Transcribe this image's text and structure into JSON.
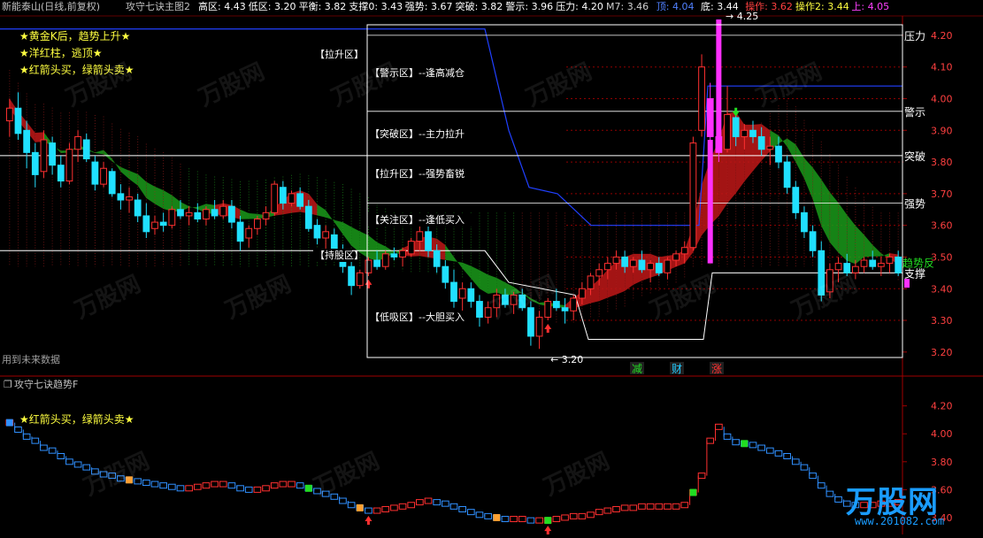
{
  "header": {
    "stock": "新能泰山(日线,前复权)",
    "indicator": "攻守七诀主图2",
    "fields": [
      {
        "label": "高区:",
        "value": "4.43",
        "color": "#ffffff"
      },
      {
        "label": "低区:",
        "value": "3.20",
        "color": "#ffffff"
      },
      {
        "label": "平衡:",
        "value": "3.82",
        "color": "#ffffff"
      },
      {
        "label": "支撑0:",
        "value": "3.43",
        "color": "#ffffff"
      },
      {
        "label": "强势:",
        "value": "3.67",
        "color": "#ffffff"
      },
      {
        "label": "突破:",
        "value": "3.82",
        "color": "#ffffff"
      },
      {
        "label": "警示:",
        "value": "3.96",
        "color": "#ffffff"
      },
      {
        "label": "压力:",
        "value": "4.20",
        "color": "#ffffff"
      },
      {
        "label": "M7:",
        "value": "3.46",
        "color": "#d0d0d0"
      },
      {
        "label": "顶:",
        "value": "4.04",
        "color": "#5080ff"
      },
      {
        "label": "底:",
        "value": "3.44",
        "color": "#ffffff"
      },
      {
        "label": "操作:",
        "value": "3.62",
        "color": "#ff4040"
      },
      {
        "label": "操作2:",
        "value": "3.44",
        "color": "#ffff40"
      },
      {
        "label": "上:",
        "value": "4.05",
        "color": "#ff40ff"
      }
    ]
  },
  "legend_notes": [
    "★黄金K后，趋势上升★",
    "★洋红柱，逃顶★",
    "★红箭头买，绿箭头卖★"
  ],
  "zone_box": {
    "title": "【拉升区】",
    "rows": [
      "【警示区】--逢高减仓",
      "【突破区】--主力拉升",
      "【拉升区】--强势畜锐",
      "【关注区】--逢低买入",
      "【持股区】",
      "【低吸区】--大胆买入"
    ]
  },
  "level_labels": [
    "压力",
    "警示",
    "突破",
    "强势",
    "支撑"
  ],
  "misc": {
    "future_warn": "用到未来数据",
    "high_mark": "4.25",
    "low_mark": "3.20",
    "right_note": "趋势反",
    "bottom_tags": [
      {
        "t": "减",
        "c": "#22dd22"
      },
      {
        "t": "财",
        "c": "#22ccff"
      },
      {
        "t": "涨",
        "c": "#ff3030"
      }
    ]
  },
  "sub_panel": {
    "title": "攻守七诀趋势F",
    "note": "★红箭头买，绿箭头卖★"
  },
  "brand": {
    "name": "万股网",
    "url": "www.201082.com",
    "watermark": "万股网"
  },
  "colors": {
    "up": "#ff3030",
    "down": "#20e0ff",
    "ma_green": "#1a9a1a",
    "ma_red": "#c01818",
    "magenta": "#ff30ff",
    "top_line": "#2040ff",
    "axis_text": "#ff4040",
    "grid": "#900000"
  },
  "chart_data": [
    {
      "type": "candlestick",
      "panel": "main",
      "ylim": [
        3.18,
        4.25
      ],
      "yticks": [
        3.2,
        3.3,
        3.4,
        3.5,
        3.6,
        3.7,
        3.8,
        3.9,
        4.0,
        4.1,
        4.2
      ],
      "levels": {
        "压力": 4.2,
        "警示": 3.96,
        "突破": 3.82,
        "强势": 3.67,
        "支撑": 3.45
      },
      "candles": [
        [
          3.93,
          4.0,
          3.88,
          3.97
        ],
        [
          3.97,
          4.02,
          3.87,
          3.89
        ],
        [
          3.9,
          3.93,
          3.78,
          3.83
        ],
        [
          3.83,
          3.86,
          3.72,
          3.76
        ],
        [
          3.77,
          3.9,
          3.75,
          3.87
        ],
        [
          3.86,
          3.88,
          3.76,
          3.79
        ],
        [
          3.79,
          3.82,
          3.72,
          3.74
        ],
        [
          3.74,
          3.86,
          3.73,
          3.84
        ],
        [
          3.84,
          3.9,
          3.8,
          3.88
        ],
        [
          3.87,
          3.89,
          3.8,
          3.81
        ],
        [
          3.8,
          3.82,
          3.71,
          3.73
        ],
        [
          3.73,
          3.8,
          3.72,
          3.78
        ],
        [
          3.77,
          3.78,
          3.69,
          3.7
        ],
        [
          3.7,
          3.73,
          3.65,
          3.68
        ],
        [
          3.68,
          3.72,
          3.64,
          3.69
        ],
        [
          3.68,
          3.7,
          3.61,
          3.63
        ],
        [
          3.63,
          3.67,
          3.56,
          3.58
        ],
        [
          3.59,
          3.63,
          3.57,
          3.61
        ],
        [
          3.61,
          3.64,
          3.58,
          3.6
        ],
        [
          3.6,
          3.66,
          3.59,
          3.65
        ],
        [
          3.65,
          3.68,
          3.62,
          3.63
        ],
        [
          3.63,
          3.66,
          3.6,
          3.64
        ],
        [
          3.64,
          3.67,
          3.61,
          3.62
        ],
        [
          3.62,
          3.66,
          3.6,
          3.65
        ],
        [
          3.65,
          3.68,
          3.62,
          3.63
        ],
        [
          3.63,
          3.68,
          3.62,
          3.66
        ],
        [
          3.66,
          3.68,
          3.59,
          3.61
        ],
        [
          3.61,
          3.63,
          3.52,
          3.55
        ],
        [
          3.56,
          3.6,
          3.53,
          3.59
        ],
        [
          3.59,
          3.63,
          3.57,
          3.62
        ],
        [
          3.62,
          3.66,
          3.6,
          3.64
        ],
        [
          3.64,
          3.74,
          3.63,
          3.73
        ],
        [
          3.72,
          3.74,
          3.65,
          3.67
        ],
        [
          3.67,
          3.71,
          3.66,
          3.7
        ],
        [
          3.7,
          3.72,
          3.65,
          3.66
        ],
        [
          3.66,
          3.68,
          3.58,
          3.59
        ],
        [
          3.6,
          3.62,
          3.54,
          3.56
        ],
        [
          3.56,
          3.6,
          3.52,
          3.58
        ],
        [
          3.57,
          3.59,
          3.5,
          3.51
        ],
        [
          3.51,
          3.54,
          3.45,
          3.47
        ],
        [
          3.47,
          3.49,
          3.38,
          3.41
        ],
        [
          3.41,
          3.46,
          3.4,
          3.45
        ],
        [
          3.45,
          3.5,
          3.44,
          3.49
        ],
        [
          3.49,
          3.52,
          3.46,
          3.47
        ],
        [
          3.47,
          3.52,
          3.46,
          3.51
        ],
        [
          3.51,
          3.53,
          3.49,
          3.5
        ],
        [
          3.5,
          3.53,
          3.47,
          3.52
        ],
        [
          3.51,
          3.56,
          3.5,
          3.55
        ],
        [
          3.55,
          3.6,
          3.52,
          3.58
        ],
        [
          3.58,
          3.6,
          3.5,
          3.52
        ],
        [
          3.52,
          3.54,
          3.45,
          3.47
        ],
        [
          3.47,
          3.49,
          3.4,
          3.42
        ],
        [
          3.42,
          3.46,
          3.34,
          3.36
        ],
        [
          3.37,
          3.42,
          3.33,
          3.4
        ],
        [
          3.4,
          3.42,
          3.34,
          3.36
        ],
        [
          3.36,
          3.38,
          3.28,
          3.31
        ],
        [
          3.31,
          3.36,
          3.29,
          3.34
        ],
        [
          3.34,
          3.4,
          3.31,
          3.38
        ],
        [
          3.38,
          3.4,
          3.34,
          3.35
        ],
        [
          3.35,
          3.39,
          3.32,
          3.38
        ],
        [
          3.38,
          3.4,
          3.33,
          3.34
        ],
        [
          3.34,
          3.36,
          3.22,
          3.25
        ],
        [
          3.25,
          3.33,
          3.21,
          3.31
        ],
        [
          3.31,
          3.37,
          3.3,
          3.36
        ],
        [
          3.36,
          3.4,
          3.33,
          3.34
        ],
        [
          3.34,
          3.37,
          3.29,
          3.33
        ],
        [
          3.33,
          3.38,
          3.3,
          3.37
        ],
        [
          3.37,
          3.42,
          3.35,
          3.4
        ],
        [
          3.4,
          3.45,
          3.38,
          3.44
        ],
        [
          3.44,
          3.48,
          3.41,
          3.46
        ],
        [
          3.46,
          3.5,
          3.43,
          3.48
        ],
        [
          3.48,
          3.52,
          3.46,
          3.5
        ],
        [
          3.5,
          3.52,
          3.45,
          3.47
        ],
        [
          3.47,
          3.5,
          3.45,
          3.49
        ],
        [
          3.49,
          3.52,
          3.45,
          3.46
        ],
        [
          3.46,
          3.49,
          3.42,
          3.48
        ],
        [
          3.48,
          3.5,
          3.44,
          3.45
        ],
        [
          3.45,
          3.5,
          3.43,
          3.49
        ],
        [
          3.49,
          3.52,
          3.47,
          3.51
        ],
        [
          3.51,
          3.55,
          3.48,
          3.53
        ],
        [
          3.53,
          3.88,
          3.52,
          3.86
        ],
        [
          3.9,
          4.14,
          3.88,
          4.1
        ],
        [
          4.0,
          4.05,
          3.85,
          3.88
        ],
        [
          3.88,
          3.92,
          3.8,
          3.83
        ],
        [
          3.84,
          4.04,
          3.83,
          3.95
        ],
        [
          3.94,
          3.96,
          3.85,
          3.88
        ],
        [
          3.88,
          3.92,
          3.84,
          3.9
        ],
        [
          3.9,
          3.93,
          3.86,
          3.88
        ],
        [
          3.88,
          3.91,
          3.82,
          3.84
        ],
        [
          3.84,
          3.88,
          3.79,
          3.85
        ],
        [
          3.85,
          3.88,
          3.78,
          3.8
        ],
        [
          3.8,
          3.82,
          3.7,
          3.72
        ],
        [
          3.72,
          3.74,
          3.62,
          3.64
        ],
        [
          3.64,
          3.66,
          3.56,
          3.58
        ],
        [
          3.58,
          3.6,
          3.5,
          3.52
        ],
        [
          3.52,
          3.55,
          3.36,
          3.38
        ],
        [
          3.39,
          3.48,
          3.37,
          3.46
        ],
        [
          3.46,
          3.5,
          3.42,
          3.48
        ],
        [
          3.48,
          3.51,
          3.44,
          3.45
        ],
        [
          3.45,
          3.49,
          3.43,
          3.47
        ],
        [
          3.47,
          3.5,
          3.45,
          3.49
        ],
        [
          3.49,
          3.52,
          3.46,
          3.47
        ],
        [
          3.47,
          3.5,
          3.44,
          3.48
        ],
        [
          3.48,
          3.51,
          3.45,
          3.5
        ],
        [
          3.5,
          3.52,
          3.44,
          3.45
        ]
      ],
      "buy_arrows": [
        42,
        63
      ],
      "sell_arrows": [
        85
      ],
      "magenta_bars": [
        82,
        83
      ]
    },
    {
      "type": "step",
      "panel": "sub",
      "ylim": [
        3.33,
        4.35
      ],
      "yticks": [
        3.4,
        3.6,
        3.8,
        4.0,
        4.2
      ],
      "series": [
        {
          "values": [
            4.08,
            4.03,
            3.98,
            3.95,
            3.9,
            3.88,
            3.84,
            3.8,
            3.78,
            3.76,
            3.73,
            3.71,
            3.7,
            3.68,
            3.67,
            3.66,
            3.65,
            3.64,
            3.63,
            3.62,
            3.61,
            3.61,
            3.62,
            3.63,
            3.64,
            3.64,
            3.63,
            3.61,
            3.6,
            3.6,
            3.61,
            3.63,
            3.64,
            3.64,
            3.63,
            3.61,
            3.59,
            3.57,
            3.55,
            3.52,
            3.49,
            3.47,
            3.45,
            3.45,
            3.46,
            3.47,
            3.48,
            3.49,
            3.51,
            3.52,
            3.51,
            3.5,
            3.48,
            3.46,
            3.44,
            3.42,
            3.41,
            3.4,
            3.39,
            3.39,
            3.39,
            3.38,
            3.38,
            3.38,
            3.39,
            3.4,
            3.41,
            3.41,
            3.42,
            3.44,
            3.45,
            3.46,
            3.47,
            3.47,
            3.48,
            3.48,
            3.48,
            3.48,
            3.48,
            3.49,
            3.58,
            3.7,
            3.95,
            4.05,
            3.98,
            3.94,
            3.93,
            3.92,
            3.9,
            3.88,
            3.86,
            3.84,
            3.8,
            3.76,
            3.7,
            3.63,
            3.57,
            3.53,
            3.5,
            3.49,
            3.49,
            3.49,
            3.5,
            3.5,
            3.51
          ]
        }
      ]
    }
  ]
}
